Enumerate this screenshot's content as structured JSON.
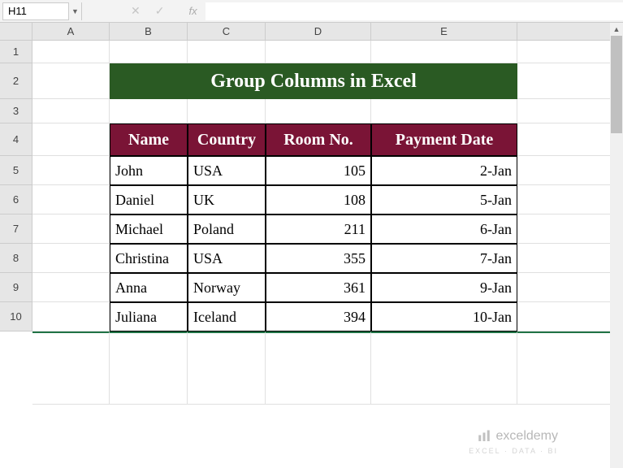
{
  "nameBox": "H11",
  "formulaBar": "",
  "columns": [
    "A",
    "B",
    "C",
    "D",
    "E"
  ],
  "rows": [
    "1",
    "2",
    "3",
    "4",
    "5",
    "6",
    "7",
    "8",
    "9",
    "10"
  ],
  "title": "Group Columns in Excel",
  "headers": {
    "name": "Name",
    "country": "Country",
    "room": "Room No.",
    "payment": "Payment Date"
  },
  "data": [
    {
      "name": "John",
      "country": "USA",
      "room": "105",
      "payment": "2-Jan"
    },
    {
      "name": "Daniel",
      "country": "UK",
      "room": "108",
      "payment": "5-Jan"
    },
    {
      "name": "Michael",
      "country": "Poland",
      "room": "211",
      "payment": "6-Jan"
    },
    {
      "name": "Christina",
      "country": "USA",
      "room": "355",
      "payment": "7-Jan"
    },
    {
      "name": "Anna",
      "country": "Norway",
      "room": "361",
      "payment": "9-Jan"
    },
    {
      "name": "Juliana",
      "country": "Iceland",
      "room": "394",
      "payment": "10-Jan"
    }
  ],
  "watermark": {
    "brand": "exceldemy",
    "tagline": "EXCEL · DATA · BI"
  },
  "chart_data": {
    "type": "table",
    "title": "Group Columns in Excel",
    "columns": [
      "Name",
      "Country",
      "Room No.",
      "Payment Date"
    ],
    "rows": [
      [
        "John",
        "USA",
        105,
        "2-Jan"
      ],
      [
        "Daniel",
        "UK",
        108,
        "5-Jan"
      ],
      [
        "Michael",
        "Poland",
        211,
        "6-Jan"
      ],
      [
        "Christina",
        "USA",
        355,
        "7-Jan"
      ],
      [
        "Anna",
        "Norway",
        361,
        "9-Jan"
      ],
      [
        "Juliana",
        "Iceland",
        394,
        "10-Jan"
      ]
    ]
  }
}
